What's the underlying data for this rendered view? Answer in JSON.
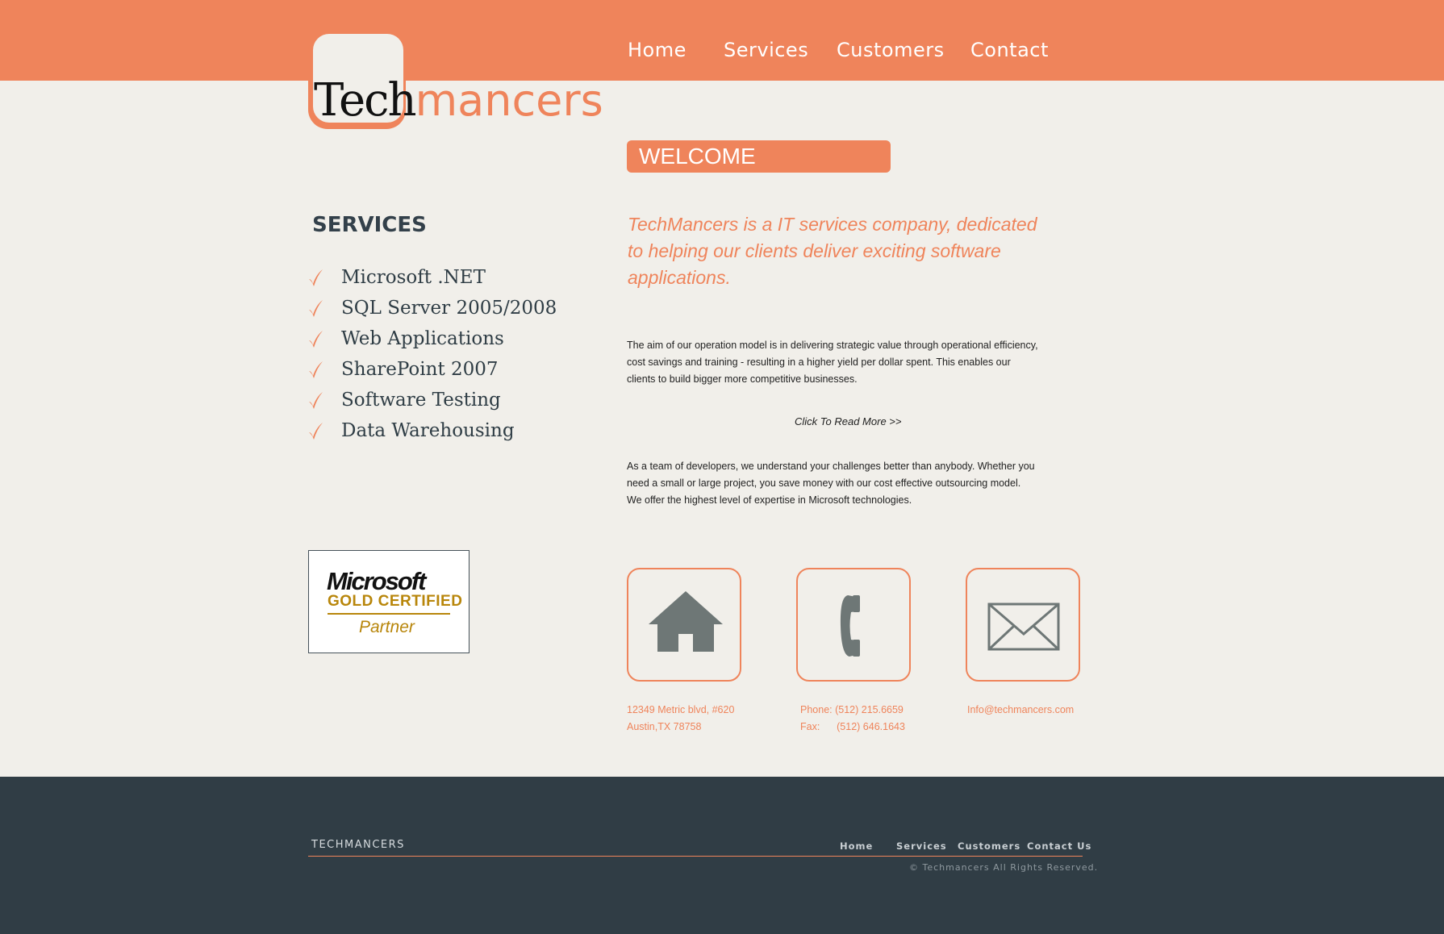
{
  "brand": {
    "logo_part1": "Tech",
    "logo_part2": "mancers",
    "accent_color": "#ef845b",
    "footer_color": "#303d45"
  },
  "nav": {
    "items": [
      "Home",
      "Services",
      "Customers",
      "Contact"
    ]
  },
  "services": {
    "title": "SERVICES",
    "items": [
      "Microsoft .NET",
      "SQL Server 2005/2008",
      "Web Applications",
      "SharePoint 2007",
      "Software Testing",
      "Data Warehousing"
    ],
    "bullet_icon": "check-icon"
  },
  "badge": {
    "brand": "Microsoft",
    "line1": "GOLD CERTIFIED",
    "line2": "Partner"
  },
  "welcome": {
    "heading": "WELCOME",
    "tagline": "TechMancers is a IT services company, dedicated to helping our clients deliver exciting software applications.",
    "para1": "The aim of our operation model is in delivering strategic value through operational efficiency, cost savings and training - resulting in a higher yield per dollar spent. This enables our clients to build bigger more competitive businesses.",
    "read_more": "Click To Read More >>",
    "para2": "As a team of developers, we understand your challenges better than anybody. Whether you need a small or large project, you save money with our cost effective outsourcing model. We offer the highest level of expertise in Microsoft technologies."
  },
  "contact": {
    "address": "12349 Metric blvd, #620\nAustin,TX 78758",
    "phone": "Phone: (512) 215.6659\nFax:      (512) 646.1643",
    "email": "Info@techmancers.com",
    "icons": [
      "home-icon",
      "phone-icon",
      "mail-icon"
    ]
  },
  "footer": {
    "brand": "TECHMANCERS",
    "nav": [
      "Home",
      "Services",
      "Customers",
      "Contact Us"
    ],
    "copyright": "© Techmancers All Rights Reserved."
  }
}
